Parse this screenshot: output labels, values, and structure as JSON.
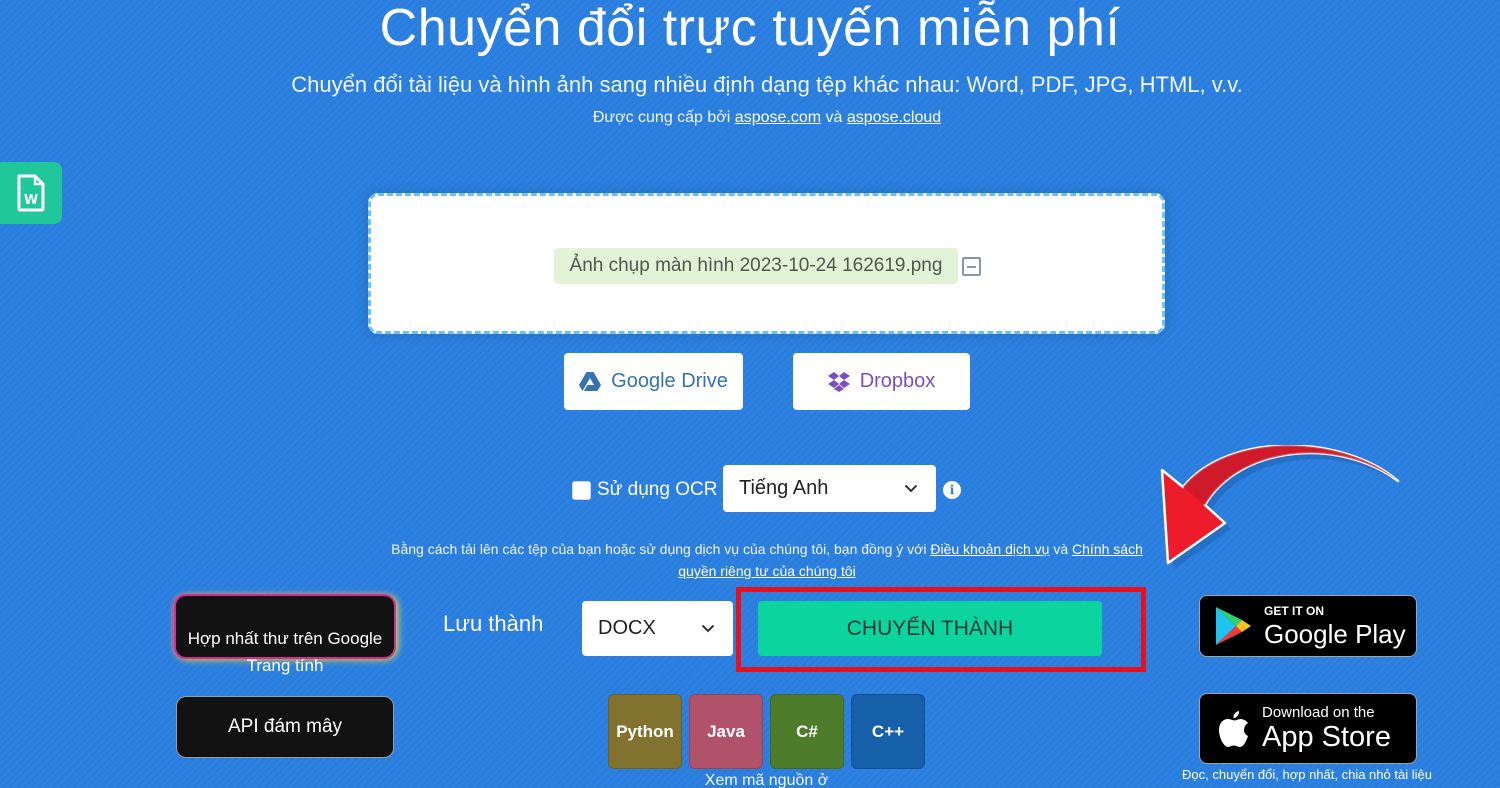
{
  "header": {
    "title": "Chuyển đổi trực tuyến miễn phí",
    "subtitle": "Chuyển đổi tài liệu và hình ảnh sang nhiều định dạng tệp khác nhau: Word, PDF, JPG, HTML, v.v.",
    "provided_by_prefix": "Được cung cấp bởi",
    "provider_link_1": "aspose.com",
    "provider_conjunction": "và",
    "provider_link_2": "aspose.cloud"
  },
  "side_tab": {
    "icon": "word-file-icon"
  },
  "upload": {
    "file_name": "Ảnh chụp màn hình 2023-10-24 162619.png",
    "remove_icon": "minus-square-icon"
  },
  "cloud_sources": [
    {
      "label": "Google Drive",
      "icon": "google-drive-icon",
      "color": "#3572b0"
    },
    {
      "label": "Dropbox",
      "icon": "dropbox-icon",
      "color": "#7a4fc2"
    }
  ],
  "ocr": {
    "checkbox_label": "Sử dụng OCR",
    "checked": false,
    "language_selected": "Tiếng Anh",
    "info_icon": "info-icon"
  },
  "terms": {
    "text": "Bằng cách tải lên các tệp của bạn hoặc sử dụng dịch vụ của chúng tôi, bạn đồng ý với",
    "terms_link": "Điều khoản dịch vụ",
    "conjunction": "và",
    "privacy_link": "Chính sách quyền riêng tư của chúng tôi"
  },
  "convert": {
    "save_as_label": "Lưu thành",
    "format_selected": "DOCX",
    "button_label": "CHUYỂN THÀNH",
    "accent_color": "#0cd49f",
    "highlight_color": "#e8101c"
  },
  "left_buttons": {
    "mail_merge": "Hợp nhất thư trên Google Trang tính",
    "cloud_api": "API đám mây"
  },
  "source_code": {
    "languages": [
      {
        "label": "Python",
        "color": "#82722f"
      },
      {
        "label": "Java",
        "color": "#b0526a"
      },
      {
        "label": "C#",
        "color": "#4d7c2a"
      },
      {
        "label": "C++",
        "color": "#1560a8"
      }
    ],
    "caption": "Xem mã nguồn ở"
  },
  "stores": {
    "google_play_small": "GET IT ON",
    "google_play_large": "Google Play",
    "app_store_small": "Download on the",
    "app_store_large": "App Store",
    "caption": "Đọc, chuyển đổi, hợp nhất, chia nhỏ tài liệu"
  }
}
